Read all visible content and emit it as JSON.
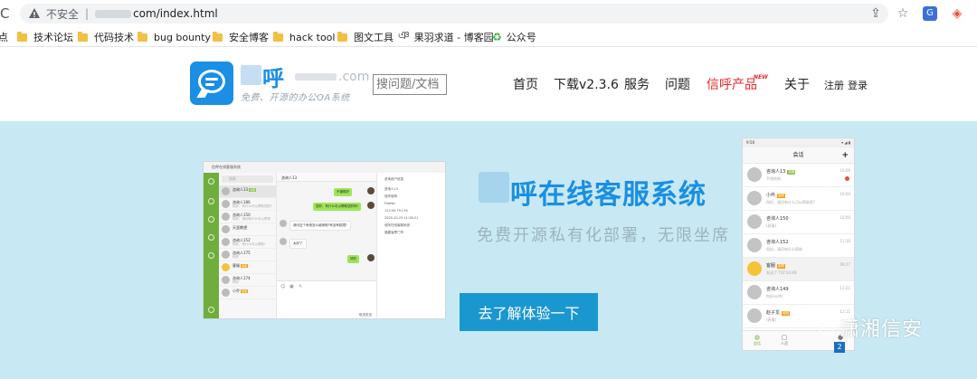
{
  "browser": {
    "security_label": "不安全",
    "url": "com/index.html",
    "bookmarks": [
      {
        "label": "点",
        "icon": "folder"
      },
      {
        "label": "技术论坛",
        "icon": "folder"
      },
      {
        "label": "代码技术",
        "icon": "folder"
      },
      {
        "label": "bug bounty",
        "icon": "folder"
      },
      {
        "label": "安全博客",
        "icon": "folder"
      },
      {
        "label": "hack tool",
        "icon": "folder"
      },
      {
        "label": "图文工具",
        "icon": "folder"
      },
      {
        "label": "果羽求道 - 博客园",
        "icon": "site"
      },
      {
        "label": "公众号",
        "icon": "site"
      }
    ]
  },
  "header": {
    "brand_char": "呼",
    "brand_domain": ".com",
    "slogan": "免费、开源的办公OA系统",
    "search_placeholder": "搜问题/文档",
    "nav": [
      "首页",
      "下载v2.3.6",
      "服务",
      "问题",
      "信呼产品",
      "关于"
    ],
    "new_badge": "NEW",
    "auth": [
      "注册",
      "登录"
    ]
  },
  "hero": {
    "title": "呼在线客服系统",
    "subtitle": "免费开源私有化部署，无限坐席",
    "cta": "去了解体验一下",
    "watermark": "潇湘信安",
    "watermark_badge": "2"
  },
  "desktop_app": {
    "window_title": "信呼在线客服系统",
    "search": "搜索",
    "chat_title": "咨询人13",
    "contacts": [
      {
        "name": "咨询人13",
        "tag": "访客",
        "tag_color": "green",
        "sub": ""
      },
      {
        "name": "咨询人186",
        "tag": "",
        "tag_color": "",
        "sub": "你好，有什么可以帮助您的?"
      },
      {
        "name": "咨询人150",
        "tag": "",
        "tag_color": "",
        "sub": "你好，请问有什么可以帮您"
      },
      {
        "name": "天涯眺望",
        "tag": "",
        "tag_color": "",
        "sub": ""
      },
      {
        "name": "咨询人152",
        "tag": "",
        "tag_color": "",
        "sub": "你好，有什么可以帮助?"
      },
      {
        "name": "咨询人175",
        "tag": "",
        "tag_color": "",
        "sub": "你好"
      },
      {
        "name": "客服",
        "tag": "客服",
        "tag_color": "orange",
        "sub": ""
      },
      {
        "name": "咨询人174",
        "tag": "",
        "tag_color": "",
        "sub": "你好"
      },
      {
        "name": "小乔",
        "tag": "客服",
        "tag_color": "orange",
        "sub": ""
      }
    ],
    "messages": [
      {
        "text": "不错很好",
        "side": "me"
      },
      {
        "text": "您好，有什么可以帮助您的吗?",
        "side": "me"
      },
      {
        "text": "请问这个系统怎么使用呢?有没有权限?",
        "side": "them"
      },
      {
        "text": "太好了",
        "side": "them"
      },
      {
        "text": "好的",
        "side": "me"
      }
    ],
    "info": [
      "咨询用户信息",
      "咨询人13",
      "信呼官网",
      "Firefox",
      "113.50.79.176",
      "2020-10-23 11:28:21",
      "信呼在线客服系统",
      "福建省厦门市"
    ],
    "buttons": "取消发送"
  },
  "mobile_app": {
    "status_time": "9:58",
    "status_right": "▾ ◢ ▮",
    "title": "会话",
    "items": [
      {
        "name": "咨询人13",
        "tag": "访客",
        "tag_color": "green",
        "sub": "不错哈哈",
        "time": "10:06",
        "dot": true
      },
      {
        "name": "小乔",
        "tag": "客服",
        "tag_color": "orange",
        "sub": "你好，请问有什么可以帮助您?",
        "time": "10:00",
        "dot": false
      },
      {
        "name": "咨询人150",
        "tag": "",
        "tag_color": "",
        "sub": "[表情]",
        "time": "10:00",
        "dot": false
      },
      {
        "name": "咨询人152",
        "tag": "",
        "tag_color": "",
        "sub": "您好，请问有什么帮助",
        "time": "11:36",
        "dot": false
      },
      {
        "name": "客服",
        "tag": "客服",
        "tag_color": "orange",
        "sub": "发送了 TGT.04 KB",
        "time": "09:27",
        "dot": false
      },
      {
        "name": "咨询人149",
        "tag": "",
        "tag_color": "",
        "sub": "你好ssdfs",
        "time": "11:21",
        "dot": false
      },
      {
        "name": "赵子龙",
        "tag": "客服",
        "tag_color": "orange",
        "sub": "[表情]",
        "time": "11:11",
        "dot": false
      }
    ],
    "tabs": [
      "会话",
      "人员",
      "我"
    ]
  },
  "colors": {
    "accent": "#1a8fe3",
    "hero_bg": "#c8e9f3",
    "cta": "#1b97d0",
    "product_red": "#e8262c",
    "rail_green": "#6fae3e"
  }
}
